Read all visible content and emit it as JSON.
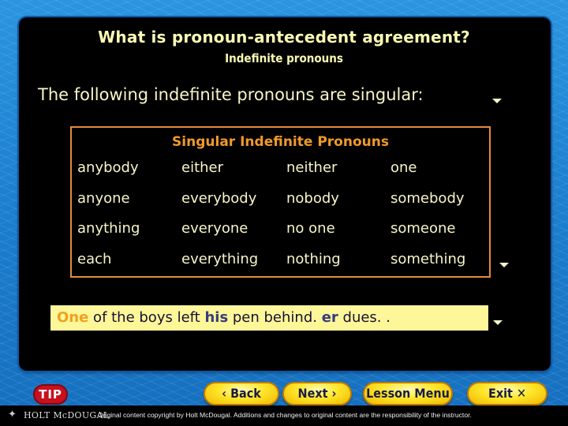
{
  "slide": {
    "title": "What is pronoun-antecedent agreement?",
    "subtitle": "Indefinite pronouns",
    "lead": "The following indefinite pronouns are singular:"
  },
  "table": {
    "title": "Singular Indefinite Pronouns",
    "rows": [
      [
        "anybody",
        "either",
        "neither",
        "one"
      ],
      [
        "anyone",
        "everybody",
        "nobody",
        "somebody"
      ],
      [
        "anything",
        "everyone",
        "no one",
        "someone"
      ],
      [
        "each",
        "everything",
        "nothing",
        "something"
      ]
    ]
  },
  "example": {
    "antecedent": "One",
    "part1": " of the boys left ",
    "pronoun": "his",
    "part2": " pen behind. ",
    "overlap_pronoun": "er",
    "part3": " dues.  ."
  },
  "icons": {
    "advance_arrow": "triangle-down",
    "logo": "holt-mcdougal-logo"
  },
  "nav": {
    "tip": "TIP",
    "back": "‹ Back",
    "next": "Next ›",
    "menu": "Lesson Menu",
    "exit": "Exit ✕"
  },
  "footer": {
    "logo": "HOLT McDOUGAL",
    "copyright": "Original content copyright by Holt McDougal. Additions and changes to original content are the responsibility of the instructor."
  },
  "colors": {
    "panel": "#000000",
    "text": "#f8f5c8",
    "table_border": "#e58a3c",
    "table_title": "#f09a2a",
    "example_bg": "#fdf79a",
    "antecedent": "#f0a020",
    "pronoun": "#3a3c7a",
    "button": "#fde62a",
    "tip": "#c8101e"
  }
}
